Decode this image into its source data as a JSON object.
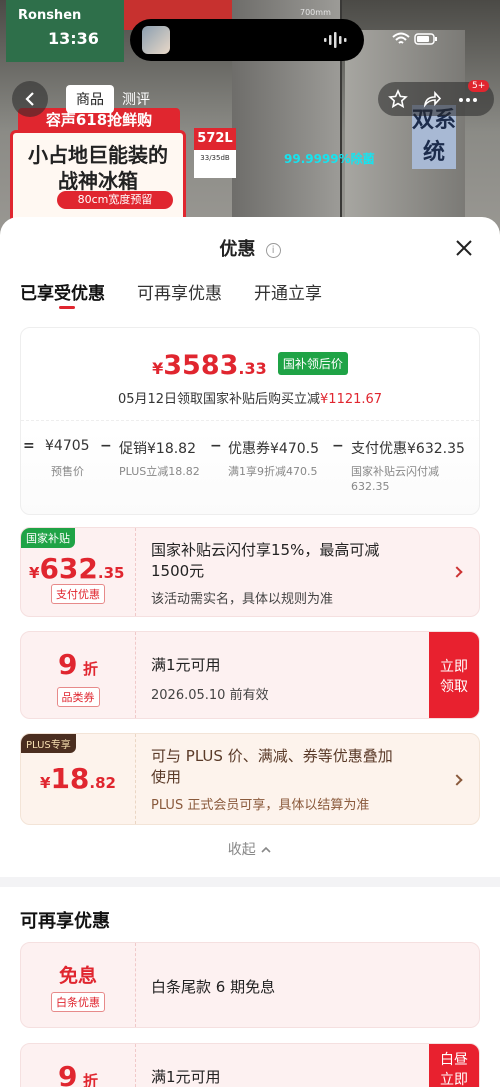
{
  "status_bar": {
    "time": "13:36"
  },
  "background": {
    "brand": "Ronshen",
    "tabs": [
      "商品",
      "测评"
    ],
    "promo_banner": "容声618抢鲜购",
    "promo_line1": "小占地巨能装的",
    "promo_line2": "战神冰箱",
    "promo_tag": "80cm宽度预留",
    "capacity": "572L",
    "noise": "33/35dB",
    "sterilize": "99.9999%除菌",
    "system_text": "双系统",
    "cart_badge": "5+",
    "dimension": "700mm"
  },
  "sheet": {
    "title": "优惠",
    "info_icon": "i",
    "tabs": [
      "已享受优惠",
      "可再享优惠",
      "开通立享"
    ],
    "summary": {
      "price_yen": "¥",
      "price_int": "3583",
      "price_dec": ".33",
      "price_tag": "国补领后价",
      "note_prefix": "05月12日领取国家补贴后购买立减",
      "note_amount": "¥1121.67",
      "calc": {
        "eq": "=",
        "presale": "¥4705",
        "presale_label": "预售价",
        "promo": "促销¥18.82",
        "promo_label": "PLUS立减18.82",
        "coupon": "优惠券¥470.5",
        "coupon_label": "满1享9折减470.5",
        "payment": "支付优惠¥632.35",
        "payment_label_1": "国家补贴云闪付减",
        "payment_label_2": "632.35",
        "minus": "−"
      }
    },
    "offers": [
      {
        "corner": "国家补贴",
        "amount_yen": "¥",
        "amount_int": "632",
        "amount_dec": ".35",
        "chip": "支付优惠",
        "title_1": "国家补贴云闪付享15%，最高可减",
        "title_2": "1500元",
        "desc": "该活动需实名，具体以规则为准"
      },
      {
        "amount_int": "9",
        "amount_unit": "折",
        "chip": "品类券",
        "title": "满1元可用",
        "desc": "2026.05.10 前有效",
        "claim_1": "立即",
        "claim_2": "领取"
      },
      {
        "corner": "PLUS专享",
        "amount_yen": "¥",
        "amount_int": "18",
        "amount_dec": ".82",
        "title_1": "可与 PLUS 价、满减、券等优惠叠加",
        "title_2": "使用",
        "desc": "PLUS 正式会员可享，具体以结算为准"
      }
    ],
    "collapse": "收起",
    "section2_title": "可再享优惠",
    "more_offers": [
      {
        "amount": "免息",
        "chip": "白条优惠",
        "title": "白条尾款 6 期免息"
      },
      {
        "amount_int": "9",
        "amount_unit": "折",
        "title": "满1元可用",
        "claim_1": "白昼",
        "claim_2": "立即"
      }
    ]
  }
}
